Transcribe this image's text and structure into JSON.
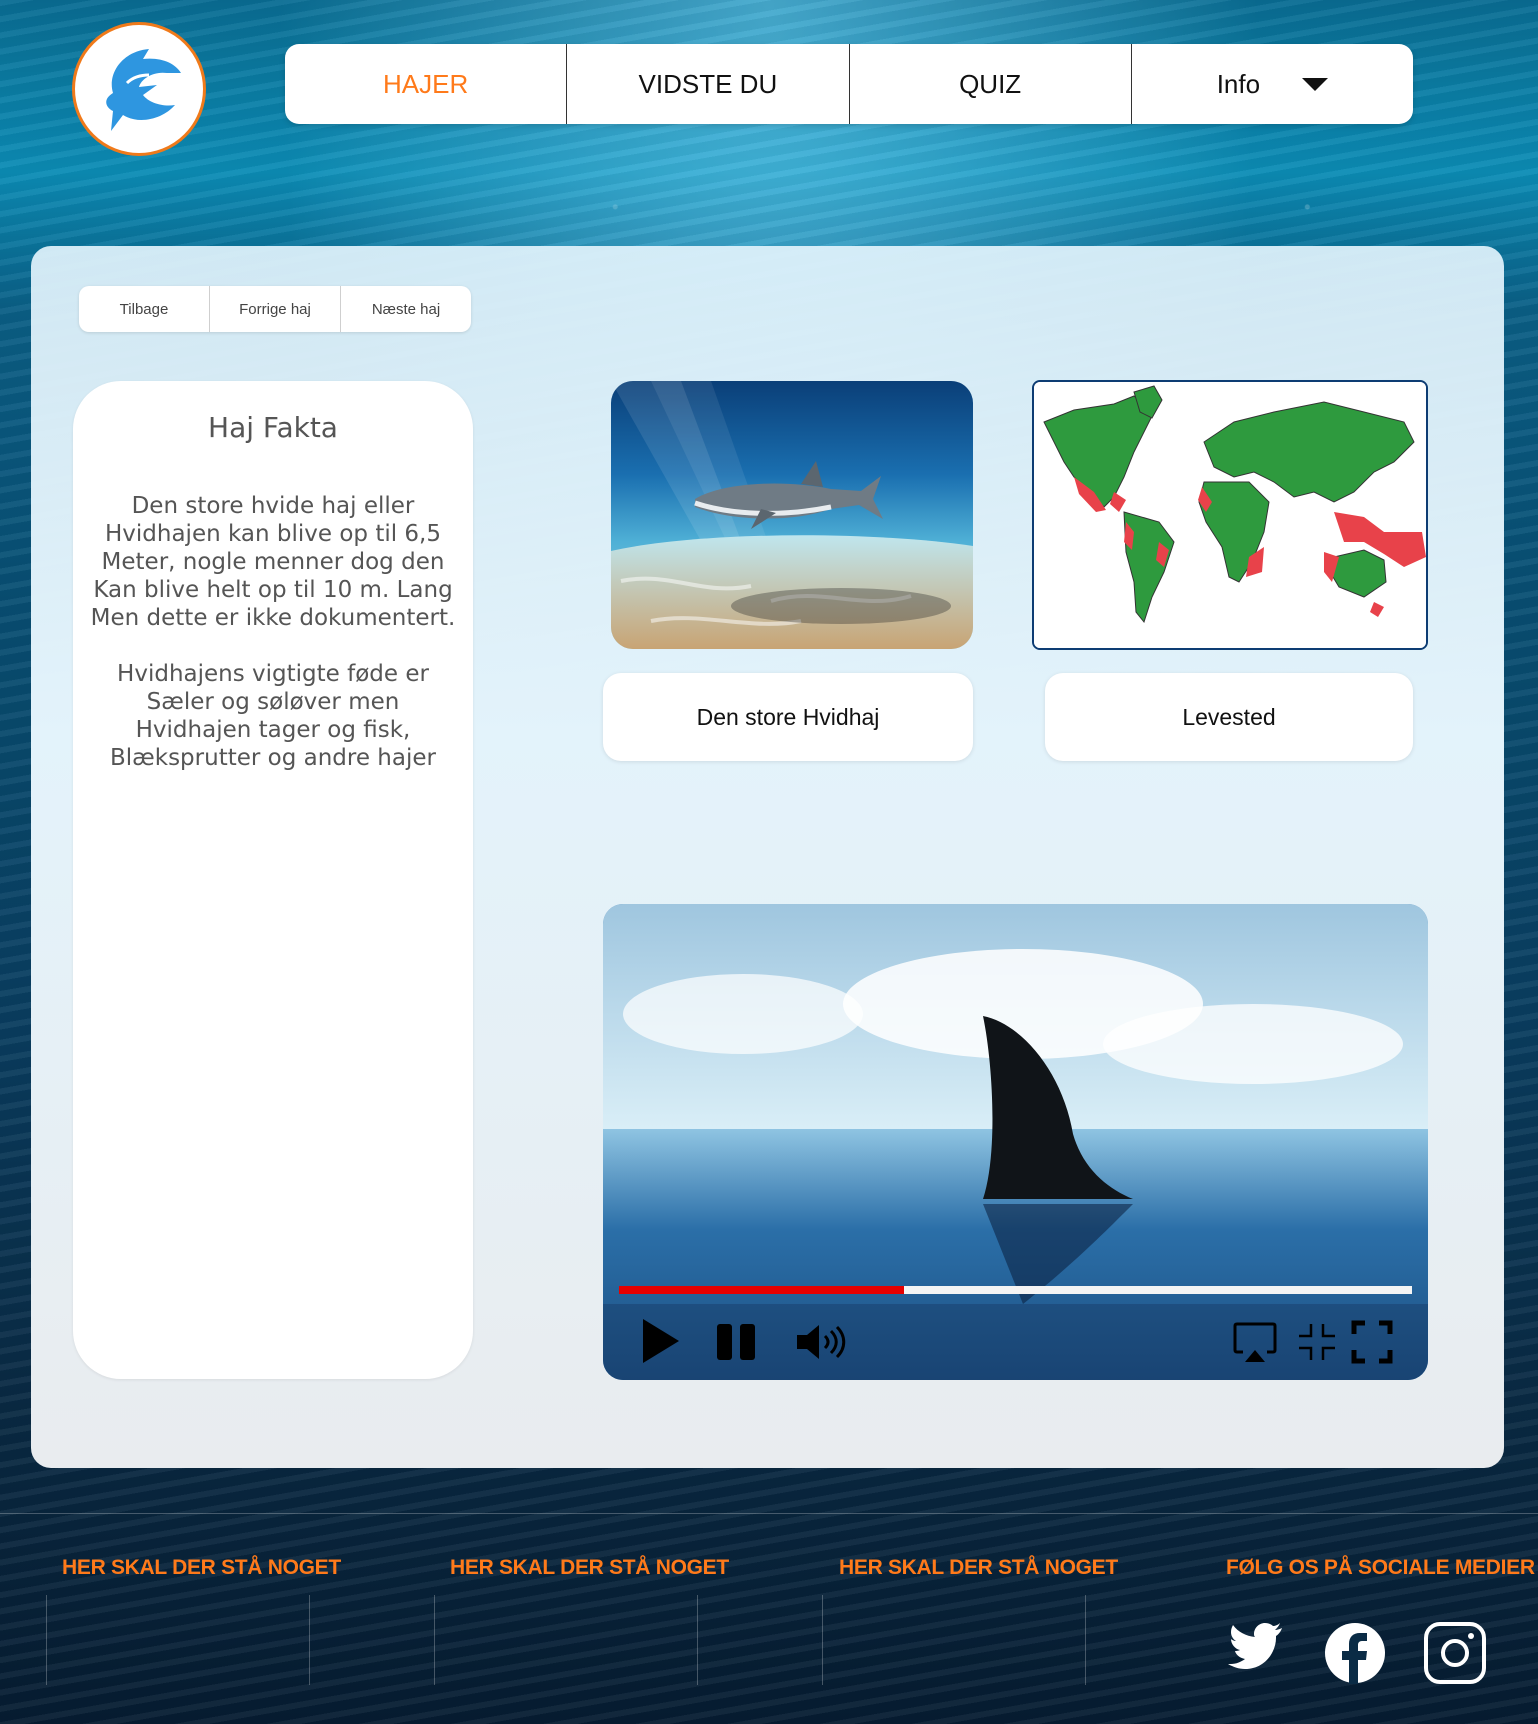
{
  "nav": {
    "items": [
      {
        "label": "HAJER",
        "active": true
      },
      {
        "label": "VIDSTE DU",
        "active": false
      },
      {
        "label": "QUIZ",
        "active": false
      },
      {
        "label": "Info",
        "active": false
      }
    ]
  },
  "subnav": {
    "back": "Tilbage",
    "prev": "Forrige haj",
    "next": "Næste haj"
  },
  "facts": {
    "title": "Haj Fakta",
    "p1_lines": [
      "Den store hvide haj eller",
      "Hvidhajen kan blive op til 6,5",
      "Meter, nogle menner dog den",
      "Kan blive helt op til 10 m. Lang",
      "Men dette er ikke dokumentert."
    ],
    "p2_lines": [
      "Hvidhajens vigtigte føde er",
      "Sæler og søløver men",
      "Hvidhajen tager og fisk,",
      "Blæksprutter og andre hajer"
    ]
  },
  "cards": {
    "shark_caption": "Den store Hvidhaj",
    "map_caption": "Levested"
  },
  "video": {
    "progress": 0.36
  },
  "footer": {
    "headings": [
      "HER SKAL DER STÅ NOGET",
      "HER SKAL DER STÅ NOGET",
      "HER SKAL DER STÅ NOGET",
      "FØLG OS PÅ SOCIALE MEDIER"
    ]
  },
  "colors": {
    "accent": "#ff7a1a",
    "progress_fill": "#e60000",
    "map_land": "#2e9a3e",
    "map_habitat": "#e8424a"
  },
  "icons": [
    "shark-logo-icon",
    "caret-down-icon",
    "play-icon",
    "pause-icon",
    "volume-icon",
    "airplay-icon",
    "exit-fullscreen-icon",
    "fullscreen-icon",
    "twitter-icon",
    "facebook-icon",
    "instagram-icon"
  ]
}
